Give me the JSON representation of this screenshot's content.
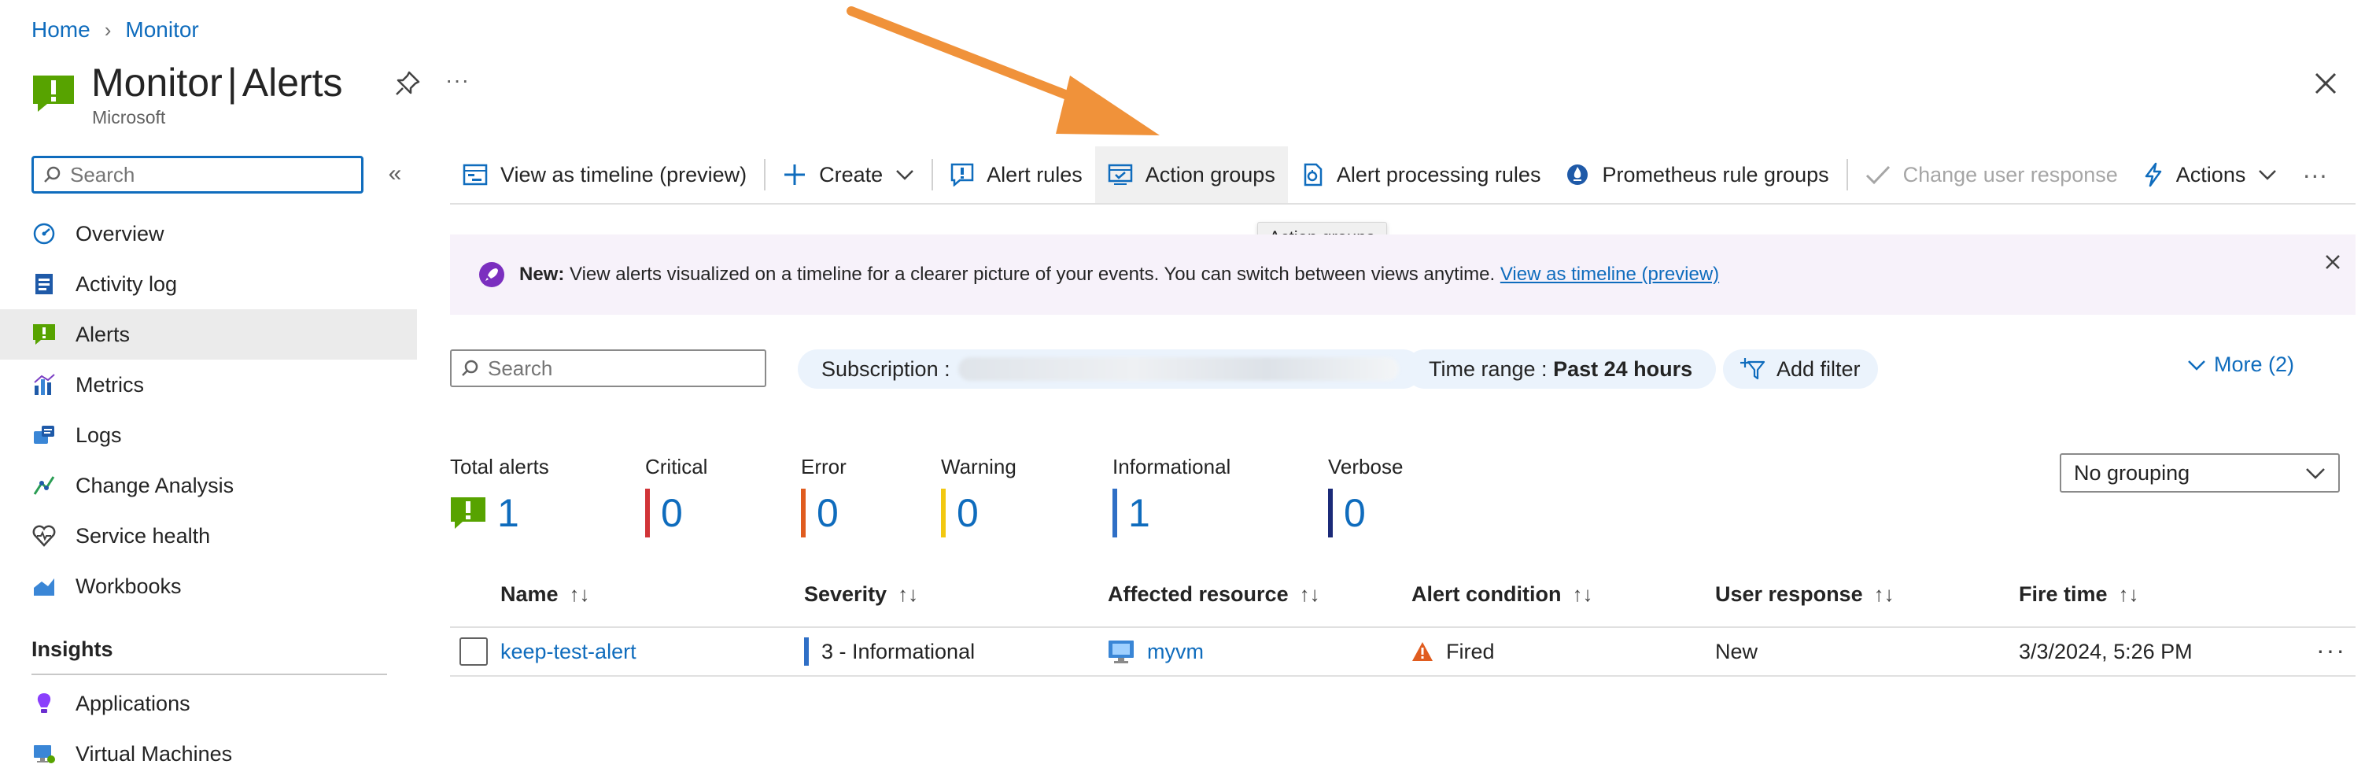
{
  "breadcrumb": [
    "Home",
    "Monitor"
  ],
  "title": {
    "main": "Monitor",
    "separator": "|",
    "section": "Alerts",
    "subtitle": "Microsoft"
  },
  "sidebar": {
    "search_placeholder": "Search",
    "items": [
      {
        "label": "Overview",
        "icon": "overview-icon"
      },
      {
        "label": "Activity log",
        "icon": "activity-log-icon"
      },
      {
        "label": "Alerts",
        "icon": "alerts-icon",
        "active": true
      },
      {
        "label": "Metrics",
        "icon": "metrics-icon"
      },
      {
        "label": "Logs",
        "icon": "logs-icon"
      },
      {
        "label": "Change Analysis",
        "icon": "change-analysis-icon"
      },
      {
        "label": "Service health",
        "icon": "service-health-icon"
      },
      {
        "label": "Workbooks",
        "icon": "workbooks-icon"
      }
    ],
    "insights_heading": "Insights",
    "insights_items": [
      {
        "label": "Applications",
        "icon": "applications-icon"
      },
      {
        "label": "Virtual Machines",
        "icon": "virtual-machines-icon"
      }
    ]
  },
  "toolbar": {
    "view_timeline": "View as timeline (preview)",
    "create": "Create",
    "alert_rules": "Alert rules",
    "action_groups": "Action groups",
    "alert_processing_rules": "Alert processing rules",
    "prometheus_rule_groups": "Prometheus rule groups",
    "change_user_response": "Change user response",
    "actions": "Actions",
    "more": "···",
    "tooltip": "Action groups"
  },
  "banner": {
    "prefix": "New:",
    "text": "View alerts visualized on a timeline for a clearer picture of your events. You can switch between views anytime.",
    "link": "View as timeline (preview)"
  },
  "filters": {
    "search_placeholder": "Search",
    "subscription_label": "Subscription :",
    "time_range_label": "Time range :",
    "time_range_value": "Past 24 hours",
    "add_filter": "Add filter",
    "more": "More (2)"
  },
  "summary": [
    {
      "label": "Total alerts",
      "value": "1",
      "color": "#57a300"
    },
    {
      "label": "Critical",
      "value": "0",
      "color": "#d13438"
    },
    {
      "label": "Error",
      "value": "0",
      "color": "#e05c1f"
    },
    {
      "label": "Warning",
      "value": "0",
      "color": "#f2c811"
    },
    {
      "label": "Informational",
      "value": "1",
      "color": "#2f6fc6"
    },
    {
      "label": "Verbose",
      "value": "0",
      "color": "#1b2a78"
    }
  ],
  "grouping": "No grouping",
  "table": {
    "columns": [
      "Name",
      "Severity",
      "Affected resource",
      "Alert condition",
      "User response",
      "Fire time"
    ],
    "sort_glyph": "↑↓",
    "rows": [
      {
        "name": "keep-test-alert",
        "severity": "3 - Informational",
        "resource": "myvm",
        "condition": "Fired",
        "user_response": "New",
        "fire_time": "3/3/2024, 5:26 PM"
      }
    ],
    "row_more": "···"
  },
  "colors": {
    "accent": "#0f6cbd",
    "annotation_arrow": "#f0923a",
    "banner_bg": "#f7f2fa"
  }
}
